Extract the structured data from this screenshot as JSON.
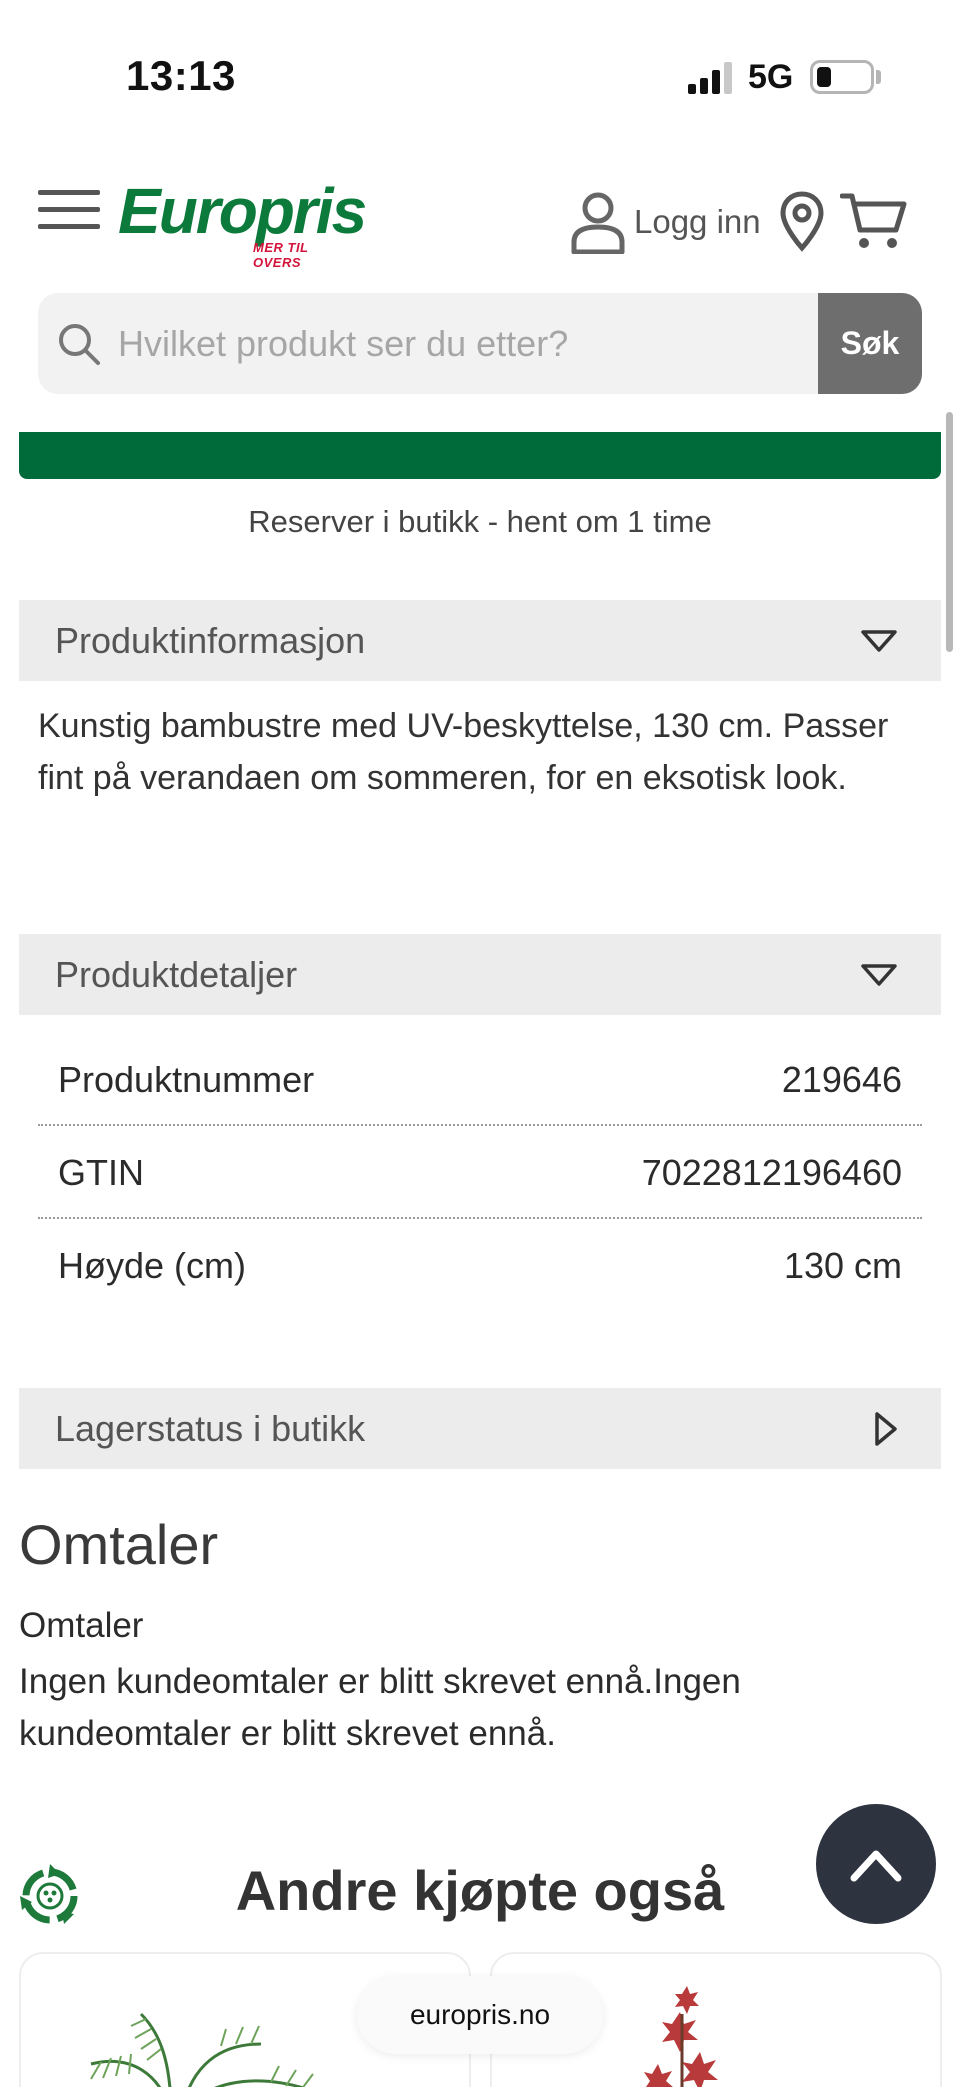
{
  "status_bar": {
    "time": "13:13",
    "network": "5G"
  },
  "header": {
    "logo_text": "Europris",
    "logo_tagline": "MER TIL OVERS",
    "login_label": "Logg inn"
  },
  "search": {
    "placeholder": "Hvilket produkt ser du etter?",
    "button_label": "Søk"
  },
  "reserve_text": "Reserver i butikk - hent om 1 time",
  "product_info": {
    "heading": "Produktinformasjon",
    "description": "Kunstig bambustre med UV-beskyttelse, 130 cm. Passer fint på verandaen om sommeren, for en eksotisk look."
  },
  "product_details": {
    "heading": "Produktdetaljer",
    "rows": [
      {
        "label": "Produktnummer",
        "value": "219646"
      },
      {
        "label": "GTIN",
        "value": "7022812196460"
      },
      {
        "label": "Høyde (cm)",
        "value": "130 cm"
      }
    ]
  },
  "stock": {
    "heading": "Lagerstatus i butikk"
  },
  "reviews": {
    "title": "Omtaler",
    "subtitle": "Omtaler",
    "text": "Ingen kundeomtaler er blitt skrevet ennå.Ingen kundeomtaler er blitt skrevet ennå."
  },
  "also_bought": {
    "title": "Andre kjøpte også"
  },
  "browser": {
    "url": "europris.no"
  },
  "colors": {
    "brand_green": "#0b7a3b",
    "button_green": "#006b3a",
    "brand_red": "#d4143a",
    "scroll_top_bg": "#2e3340"
  },
  "icons": [
    "menu-icon",
    "user-icon",
    "location-pin-icon",
    "cart-icon",
    "search-icon",
    "chevron-down-icon",
    "chevron-right-icon",
    "chevron-up-icon",
    "recycle-icon"
  ]
}
